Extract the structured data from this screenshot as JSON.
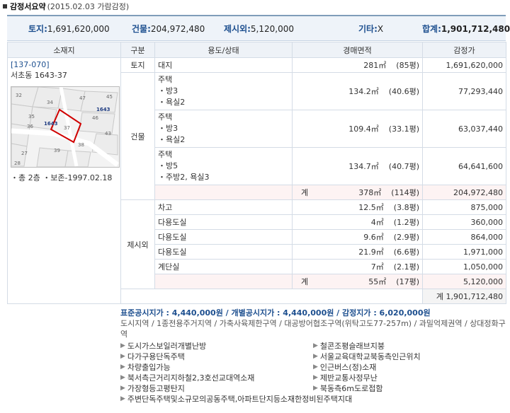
{
  "header": {
    "title": "감정서요약",
    "date": "(2015.02.03 가람감정)"
  },
  "summary": {
    "land_label": "토지:",
    "land_value": "1,691,620,000",
    "building_label": "건물:",
    "building_value": "204,972,480",
    "extra_label": "제시외:",
    "extra_value": "5,120,000",
    "other_label": "기타:",
    "other_value": "X",
    "total_label": "합계:",
    "total_value": "1,901,712,480"
  },
  "table": {
    "headers": [
      "소재지",
      "구분",
      "용도/상태",
      "경매면적",
      "감정가"
    ],
    "address_code": "[137-070]",
    "address": "서초동 1643-37",
    "address_note": "・총 2층 ・보존-1997.02.18",
    "map_labels": [
      "32",
      "34",
      "47",
      "45",
      "35",
      "1643",
      "46",
      "36",
      "1643",
      "37",
      "43",
      "27",
      "39",
      "38",
      "28"
    ],
    "land": {
      "cat": "토지",
      "use": "대지",
      "area": "281㎡",
      "pyeong": "(85평)",
      "price": "1,691,620,000"
    },
    "building_cat": "건물",
    "buildings": [
      {
        "use": "주택\n・방3\n・욕실2",
        "area": "134.2㎡",
        "pyeong": "(40.6평)",
        "price": "77,293,440"
      },
      {
        "use": "주택\n・방3\n・욕실2",
        "area": "109.4㎡",
        "pyeong": "(33.1평)",
        "price": "63,037,440"
      },
      {
        "use": "주택\n・방5\n・주방2, 욕실3",
        "area": "134.7㎡",
        "pyeong": "(40.7평)",
        "price": "64,641,600"
      }
    ],
    "building_total": {
      "label": "계",
      "area": "378㎡",
      "pyeong": "(114평)",
      "price": "204,972,480"
    },
    "extra_cat": "제시외",
    "extras": [
      {
        "use": "차고",
        "area": "12.5㎡",
        "pyeong": "(3.8평)",
        "price": "875,000"
      },
      {
        "use": "다용도실",
        "area": "4㎡",
        "pyeong": "(1.2평)",
        "price": "360,000"
      },
      {
        "use": "다용도실",
        "area": "9.6㎡",
        "pyeong": "(2.9평)",
        "price": "864,000"
      },
      {
        "use": "다용도실",
        "area": "21.9㎡",
        "pyeong": "(6.6평)",
        "price": "1,971,000"
      },
      {
        "use": "계단실",
        "area": "7㎡",
        "pyeong": "(2.1평)",
        "price": "1,050,000"
      }
    ],
    "extra_total": {
      "label": "계",
      "area": "55㎡",
      "pyeong": "(17평)",
      "price": "5,120,000"
    },
    "grand_total": "계 1,901,712,480"
  },
  "bottom": {
    "prices": "표준공시지가 : 4,440,000원 / 개별공시지가 : 4,440,000원 / 감정지가 : 6,020,000원",
    "zones": "도시지역 / 1종전용주거지역 / 가축사육제한구역 / 대공방어협조구역(위탁고도77-257m) / 과밀억제권역 / 상대정화구역",
    "features_left": [
      "도시가스보일러개별난방",
      "다가구용단독주택",
      "차량출입가능",
      "북서측근거리지하철2,3호선교대역소재",
      "가장형등고평탄지",
      "주변단독주택및소규모의공동주택,아파트단지등소재한정비된주택지대"
    ],
    "features_right": [
      "철콘조평슬래브지붕",
      "서울교육대학교북동측인근위치",
      "인근버스(정)소재",
      "제반교통사정무난",
      "북동측6m도로접함"
    ]
  }
}
